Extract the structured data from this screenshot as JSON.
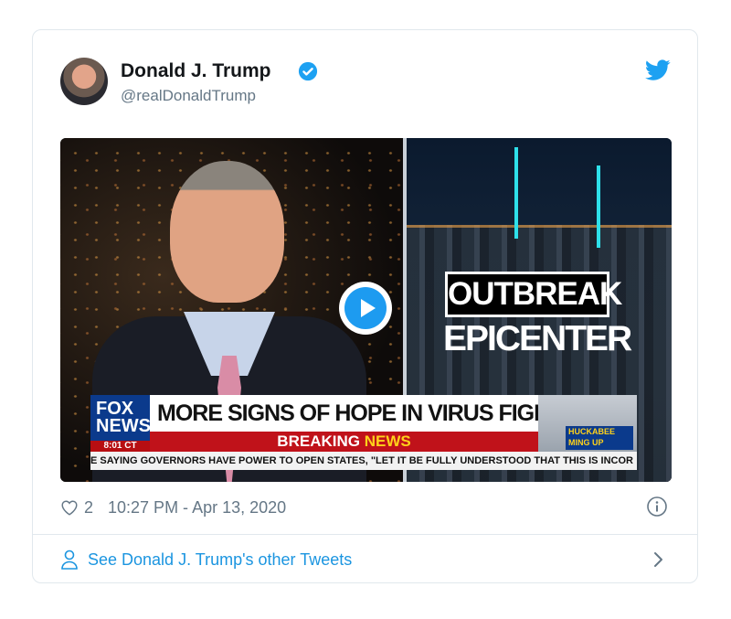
{
  "tweet": {
    "display_name": "Donald J. Trump",
    "handle": "@realDonaldTrump",
    "likes": "2",
    "timestamp": "10:27 PM - Apr 13, 2020",
    "see_other_tweets": "See Donald J. Trump's other Tweets"
  },
  "media": {
    "outbreak_text": "OUTBREAK",
    "epicenter_text": "EPICENTER",
    "network_logo_line1": "FOX",
    "network_logo_line2": "NEWS",
    "network_time": "8:01 CT",
    "headline": "MORE SIGNS OF HOPE IN VIRUS FIGHT",
    "breaking_word": "BREAKING",
    "news_word": "NEWS",
    "promo_line1": "HUCKABEE",
    "promo_line2": "MING UP",
    "ticker": "E SAYING GOVERNORS HAVE POWER TO OPEN STATES, \"LET IT BE FULLY UNDERSTOOD THAT THIS IS INCOR"
  },
  "colors": {
    "brand_blue": "#1da1f2",
    "link_blue": "#1b95e0",
    "muted_text": "#657786"
  },
  "icons": {
    "verified": "verified-badge-icon",
    "bird": "twitter-bird-icon",
    "play": "play-icon",
    "heart": "heart-icon",
    "info": "info-icon",
    "person": "person-icon",
    "chevron": "chevron-right-icon"
  }
}
